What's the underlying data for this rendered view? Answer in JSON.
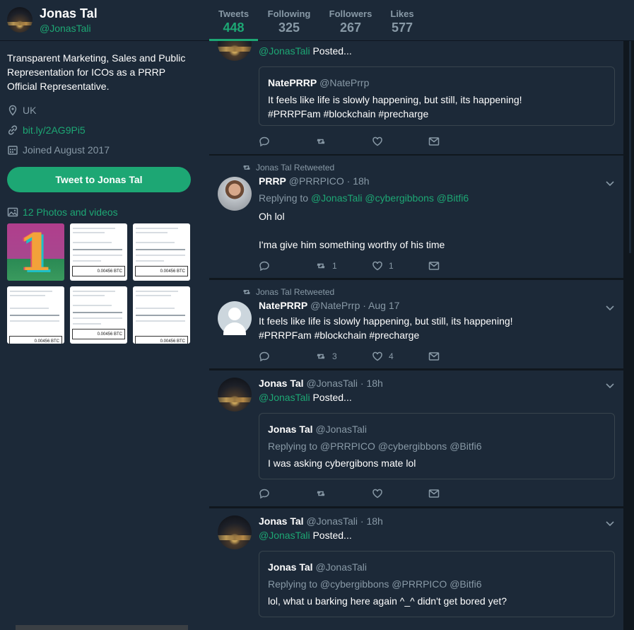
{
  "profile": {
    "name": "Jonas Tal",
    "handle": "@JonasTali",
    "bio": "Transparent Marketing, Sales and Public Representation for ICOs as a PRRP Official Representative.",
    "location": "UK",
    "link": "bit.ly/2AG9Pi5",
    "joined": "Joined August 2017",
    "tweet_to_label": "Tweet to Jonas Tal",
    "photos_label": "12 Photos and videos",
    "thumb_btc_amount": "0.00456 BTC"
  },
  "nav": [
    {
      "label": "Tweets",
      "value": "448",
      "active": true
    },
    {
      "label": "Following",
      "value": "325"
    },
    {
      "label": "Followers",
      "value": "267"
    },
    {
      "label": "Likes",
      "value": "577"
    }
  ],
  "tweets": [
    {
      "posted_handle": "@JonasTali",
      "posted_text": "Posted...",
      "quote": {
        "name": "NatePRRP",
        "handle": "@NatePrrp",
        "body_line1": "It feels like life is slowly happening, but still, its happening!",
        "body_line2": "#PRRPFam #blockchain #precharge"
      }
    },
    {
      "retweet_label": "Jonas Tal Retweeted",
      "name": "PRRP",
      "handle_time": "@PRRPICO · 18h",
      "replying_prefix": "Replying to",
      "replying_handles": "@JonasTali @cybergibbons @Bitfi6",
      "line1": "Oh lol",
      "line2": "I'ma give him something worthy of his time",
      "retweets": "1",
      "likes": "1"
    },
    {
      "retweet_label": "Jonas Tal Retweeted",
      "name": "NatePRRP",
      "handle_time": "@NatePrrp · Aug 17",
      "line1": "It feels like life is slowly happening, but still, its happening!",
      "hashtags": "#PRRPFam #blockchain #precharge",
      "retweets": "3",
      "likes": "4"
    },
    {
      "name": "Jonas Tal",
      "handle_time": "@JonasTali · 18h",
      "posted_handle": "@JonasTali",
      "posted_text": "Posted...",
      "quote": {
        "name": "Jonas Tal",
        "handle": "@JonasTali",
        "replying": "Replying to @PRRPICO @cybergibbons @Bitfi6",
        "body": "I was asking cybergibons  mate lol"
      }
    },
    {
      "name": "Jonas Tal",
      "handle_time": "@JonasTali · 18h",
      "posted_handle": "@JonasTali",
      "posted_text": "Posted...",
      "quote": {
        "name": "Jonas Tal",
        "handle": "@JonasTali",
        "replying": "Replying to @cybergibbons @PRRPICO @Bitfi6",
        "body": "lol, what u barking here again ^_^ didn't get bored yet?"
      }
    }
  ],
  "colors": {
    "accent": "#1da774",
    "panel": "#1c2938",
    "background": "#10171e",
    "muted": "#8899a6"
  }
}
